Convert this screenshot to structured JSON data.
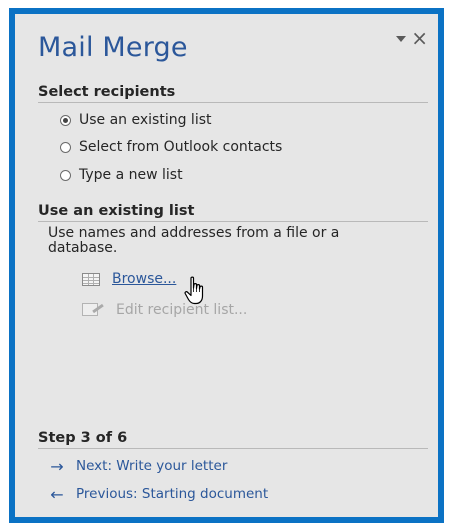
{
  "pane": {
    "title": "Mail Merge",
    "dropdown_icon": "chevron-down-icon",
    "close_symbol": "×"
  },
  "select_recipients": {
    "heading": "Select recipients",
    "options": [
      {
        "label": "Use an existing list",
        "selected": true
      },
      {
        "label": "Select from Outlook contacts",
        "selected": false
      },
      {
        "label": "Type a new list",
        "selected": false
      }
    ]
  },
  "existing_list": {
    "heading": "Use an existing list",
    "description": "Use names and addresses from a file or a database.",
    "browse_label": "Browse...",
    "edit_label": "Edit recipient list..."
  },
  "step": {
    "heading": "Step 3 of 6",
    "next_arrow": "→",
    "next_label": "Next: Write your letter",
    "prev_arrow": "←",
    "prev_label": "Previous: Starting document"
  },
  "colors": {
    "frame_border": "#0b72c4",
    "pane_bg": "#e6e6e6",
    "accent": "#2b579a"
  }
}
